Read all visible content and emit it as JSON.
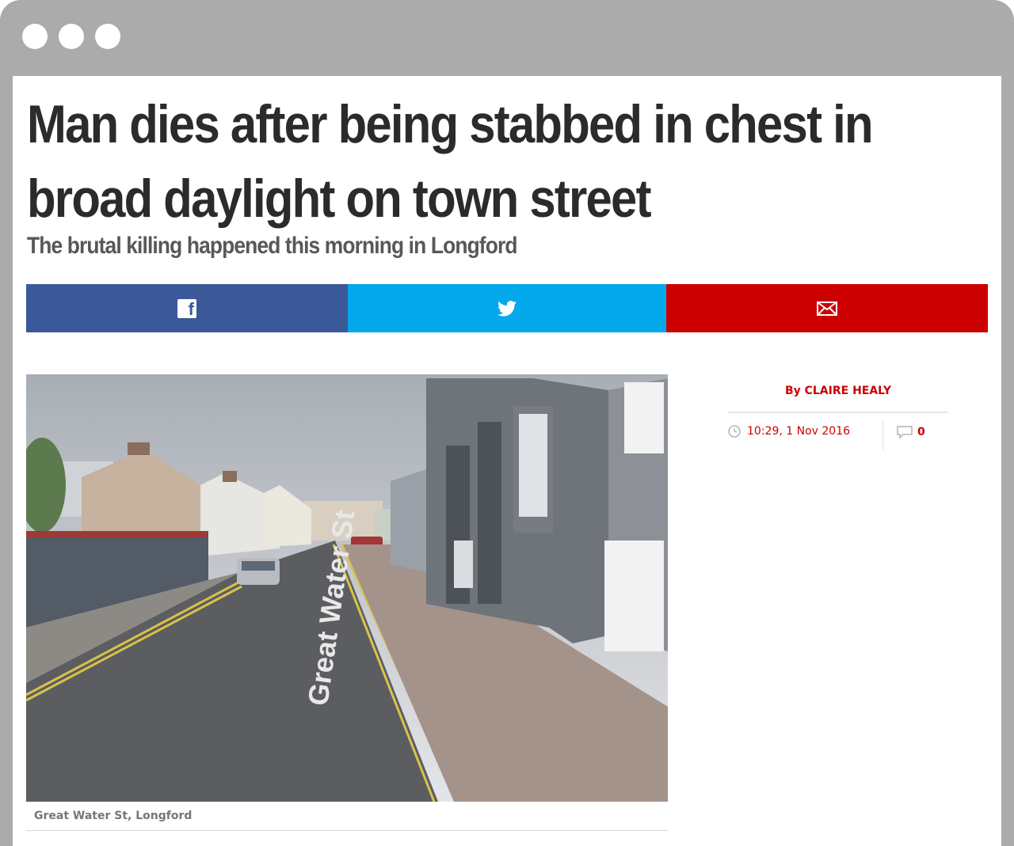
{
  "article": {
    "headline": "Man dies after being stabbed in chest in broad daylight on town street",
    "subheadline": "The brutal killing happened this morning in Longford",
    "photo_caption": "Great Water St, Longford",
    "photo_street_label": "Great Water St",
    "byline": "By CLAIRE HEALY",
    "timestamp": "10:29, 1 Nov 2016",
    "comment_count": "0"
  },
  "share": {
    "facebook_icon": "facebook-icon",
    "twitter_icon": "twitter-icon",
    "email_icon": "email-icon"
  },
  "colors": {
    "facebook": "#3b5998",
    "twitter": "#03a9eb",
    "email": "#cc0000",
    "accent": "#cc0000"
  }
}
